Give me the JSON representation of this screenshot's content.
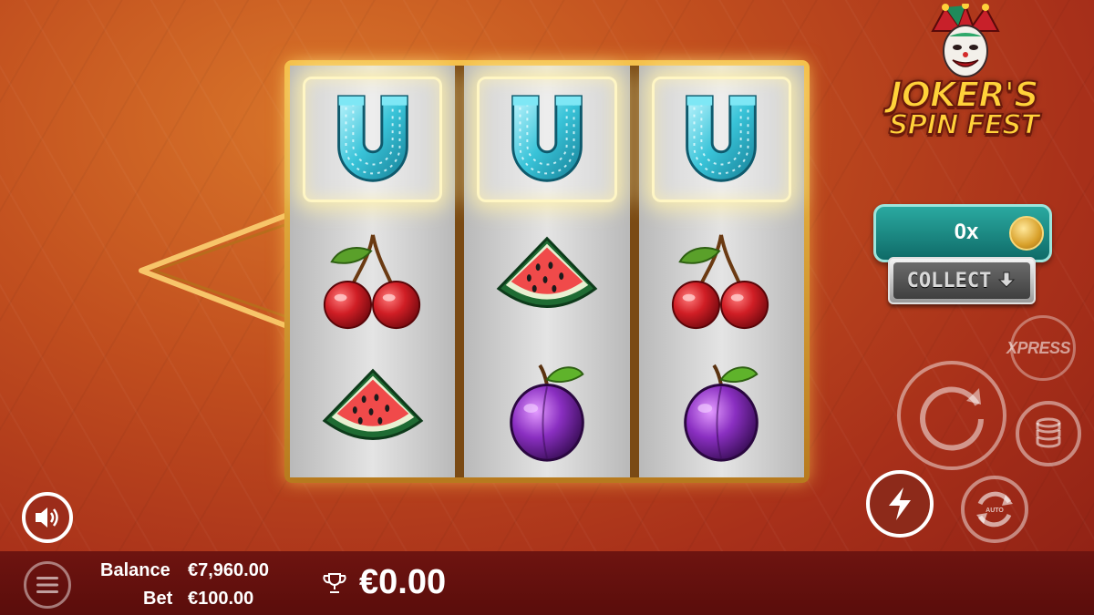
{
  "game": {
    "logo_line1": "JOKER'S",
    "logo_line2": "SPIN FEST"
  },
  "reels": [
    {
      "symbols": [
        "horseshoe",
        "cherries",
        "watermelon"
      ],
      "winning_row": 0
    },
    {
      "symbols": [
        "horseshoe",
        "watermelon",
        "plum"
      ],
      "winning_row": 0
    },
    {
      "symbols": [
        "horseshoe",
        "cherries",
        "plum"
      ],
      "winning_row": 0
    }
  ],
  "multiplier": {
    "value": "0x",
    "icon": "coin-stack-icon"
  },
  "collect": {
    "label": "COLLECT",
    "icon": "download-arrow-icon"
  },
  "controls": {
    "xpress_label": "XPRESS",
    "spin_icon": "spin-arrow-icon",
    "stake_icon": "coin-stack-icon",
    "turbo_icon": "lightning-icon",
    "auto_icon": "autoplay-icon",
    "auto_label": "AUTO",
    "sound_icon": "speaker-icon",
    "menu_icon": "hamburger-icon"
  },
  "stats": {
    "balance_label": "Balance",
    "balance_value": "€7,960.00",
    "bet_label": "Bet",
    "bet_value": "€100.00",
    "win_icon": "trophy-icon",
    "win_value": "€0.00"
  },
  "colors": {
    "frame_gold": "#f5c04a",
    "panel_teal": "#2aa9a0",
    "bottom_bar": "#6e1410",
    "background": "#c2501f"
  }
}
